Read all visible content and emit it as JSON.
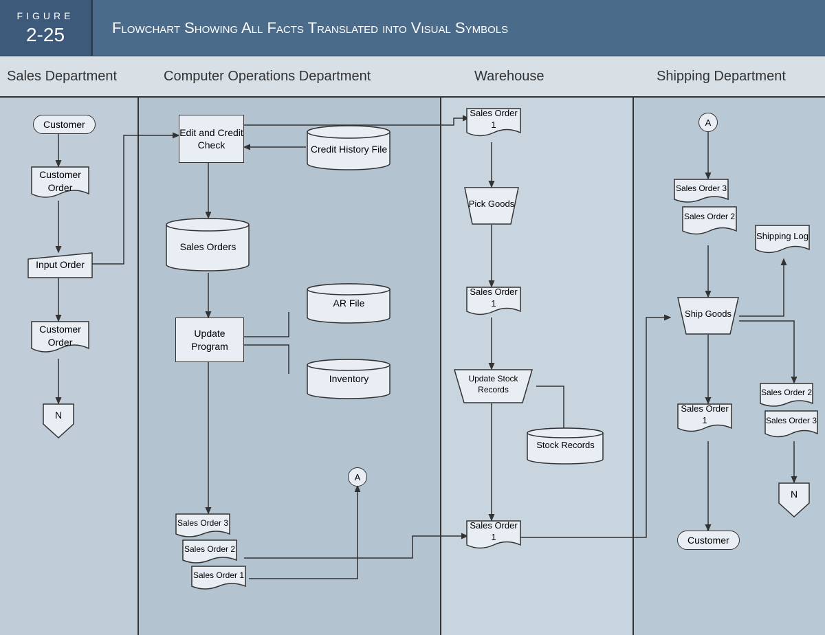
{
  "header": {
    "figure_label": "FIGURE",
    "figure_number": "2-25",
    "title": "Flowchart Showing All Facts Translated into Visual Symbols"
  },
  "columns": {
    "sales": "Sales Department",
    "computer": "Computer Operations Department",
    "warehouse": "Warehouse",
    "shipping": "Shipping Department"
  },
  "nodes": {
    "customer_start": "Customer",
    "customer_order_1": "Customer Order",
    "input_order": "Input Order",
    "customer_order_2": "Customer Order",
    "offpage_n1": "N",
    "edit_credit": "Edit and Credit Check",
    "credit_history": "Credit History File",
    "sales_orders_db": "Sales Orders",
    "update_program": "Update Program",
    "ar_file": "AR File",
    "inventory": "Inventory",
    "connector_a_out": "A",
    "so3_comp": "Sales Order 3",
    "so2_comp": "Sales Order 2",
    "so1_comp": "Sales Order 1",
    "so1_wh_top": "Sales Order 1",
    "pick_goods": "Pick Goods",
    "so1_wh_mid": "Sales Order 1",
    "update_stock": "Update Stock Records",
    "stock_records": "Stock Records",
    "so1_wh_bot": "Sales Order 1",
    "connector_a_in": "A",
    "so3_ship": "Sales Order 3",
    "so2_ship": "Sales Order 2",
    "ship_goods": "Ship Goods",
    "so1_ship_out": "Sales Order 1",
    "customer_end": "Customer",
    "shipping_log": "Shipping Log",
    "so2_ship_out": "Sales Order 2",
    "so3_ship_out": "Sales Order 3",
    "offpage_n2": "N"
  }
}
